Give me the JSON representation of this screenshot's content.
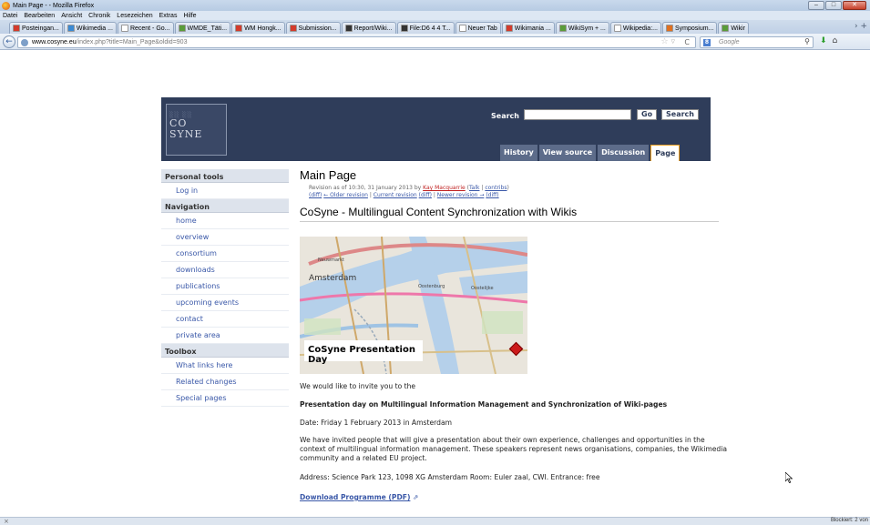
{
  "window": {
    "title": "Main Page - - Mozilla Firefox"
  },
  "menubar": [
    "Datei",
    "Bearbeiten",
    "Ansicht",
    "Chronik",
    "Lesezeichen",
    "Extras",
    "Hilfe"
  ],
  "tabs": [
    {
      "label": "Posteingan...",
      "color": "#d33b2c"
    },
    {
      "label": "Wikimedia ...",
      "color": "#3b8ad3"
    },
    {
      "label": "Recent - Go...",
      "color": "#ffffff"
    },
    {
      "label": "WMDE_Täti...",
      "color": "#5a9c3a"
    },
    {
      "label": "WM Hongk...",
      "color": "#d33b2c"
    },
    {
      "label": "Submission...",
      "color": "#d33b2c"
    },
    {
      "label": "Report/Wiki...",
      "color": "#333333"
    },
    {
      "label": "File:D6 4 4 T...",
      "color": "#333333"
    },
    {
      "label": "Neuer Tab",
      "color": "#ffffff"
    },
    {
      "label": "Wikimania ...",
      "color": "#d33b2c"
    },
    {
      "label": "WikiSym + ...",
      "color": "#5a9c3a"
    },
    {
      "label": "Wikipedia:...",
      "color": "#ffffff"
    },
    {
      "label": "Symposium...",
      "color": "#e07020"
    },
    {
      "label": "Wikir",
      "color": "#5a9c3a"
    }
  ],
  "navbar": {
    "url_host": "www.cosyne.eu",
    "url_path": "/index.php?title=Main_Page&oldid=903",
    "search_placeholder": "Google"
  },
  "header": {
    "logo_text": [
      "CO",
      "SYNE"
    ],
    "search_label": "Search",
    "go_label": "Go",
    "search_button_label": "Search",
    "tabs": [
      {
        "label": "History",
        "active": false
      },
      {
        "label": "View source",
        "active": false
      },
      {
        "label": "Discussion",
        "active": false
      },
      {
        "label": "Page",
        "active": true
      }
    ]
  },
  "sidebar": {
    "sections": [
      {
        "title": "Personal tools",
        "items": [
          "Log in"
        ]
      },
      {
        "title": "Navigation",
        "items": [
          "home",
          "overview",
          "consortium",
          "downloads",
          "publications",
          "upcoming events",
          "contact",
          "private area"
        ]
      },
      {
        "title": "Toolbox",
        "items": [
          "What links here",
          "Related changes",
          "Special pages"
        ]
      }
    ]
  },
  "content": {
    "page_title": "Main Page",
    "rev_prefix": "Revision as of 10:30, 31 January 2013 by ",
    "rev_user": "Kay Macquarrie",
    "rev_talk": "Talk",
    "rev_contribs": "contribs",
    "rev_diff": "(diff)",
    "rev_older": "← Older revision",
    "rev_current": "Current revision",
    "rev_diff2": "(diff)",
    "rev_newer": "Newer revision →",
    "rev_diff3": "(diff)",
    "section_title": "CoSyne - Multilingual Content Synchronization with Wikis",
    "map_caption": "CoSyne Presentation Day",
    "map_labels": [
      "Amsterdam",
      "Neuwmarkt",
      "Oostenburg",
      "Oostelijke"
    ],
    "intro": "We would like to invite you to the",
    "event_title": "Presentation day on Multilingual Information Management and Synchronization of Wiki-pages",
    "date": "Date: Friday 1 February 2013 in Amsterdam",
    "description": "We have invited people that will give a presentation about their own experience, challenges and opportunities in the context of multilingual information management. These speakers represent news organisations, companies, the Wikimedia community and a related EU project.",
    "address": "Address: Science Park 123, 1098 XG Amsterdam Room: Euler zaal, CWI. Entrance: free",
    "download_link": "Download Programme (PDF)"
  },
  "statusbar": {
    "right_text": "Blockiert: 2 von"
  }
}
